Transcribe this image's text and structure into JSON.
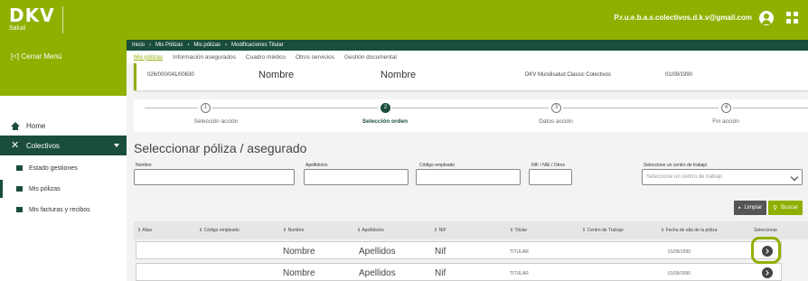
{
  "header": {
    "logo_text": "DKV",
    "logo_sub": "Salud",
    "user_email": "P.r.u.e.b.a.s.colectivos.d.k.v@gmail.com",
    "icons": [
      "user-icon",
      "apps-grid-icon"
    ]
  },
  "sidebar": {
    "close_menu": "[<] Cerrar Menú",
    "items": [
      {
        "label": "Home",
        "icon": "home-icon"
      },
      {
        "label": "Colectivos",
        "icon": "colectivos-icon"
      }
    ],
    "subitems": [
      {
        "label": "Estado gestiones",
        "icon": "document-icon"
      },
      {
        "label": "Mis pólizas",
        "icon": "policy-icon"
      },
      {
        "label": "Mis facturas y recibos",
        "icon": "invoice-icon"
      }
    ]
  },
  "breadcrumb": [
    "Inicio",
    "Mis Pólizas",
    "Mis pólizas",
    "Modificaciones Titular"
  ],
  "tabs": [
    "Mis pólizas",
    "Información asegurados",
    "Cuadro médico",
    "Otros servicios",
    "Gestión documental"
  ],
  "policy": {
    "number": "026/000/041/00630",
    "name1": "Nombre",
    "name2": "Nombre",
    "product": "DKV Mundisalud Classic Colectivos",
    "date": "01/09/1990"
  },
  "steps": [
    {
      "num": "1",
      "label": "Selección acción"
    },
    {
      "num": "2",
      "label": "Selección orden"
    },
    {
      "num": "3",
      "label": "Datos acción"
    },
    {
      "num": "4",
      "label": "Fin acción"
    }
  ],
  "form": {
    "title": "Seleccionar póliza / asegurado",
    "labels": {
      "nombre": "Nombre",
      "apellidos": "Apellido/os",
      "codigo": "Código empleado",
      "nif": "NIF / NIE / Otros",
      "centro": "Seleccione un centro de trabajo"
    },
    "centro_placeholder": "Seleccione un centro de trabajo",
    "clear_label": "Limpiar",
    "search_label": "Buscar"
  },
  "table": {
    "headers": [
      "Alias",
      "Código empleado",
      "Nombre",
      "Apellido/os",
      "NIF",
      "Titular",
      "Centro de Trabajo",
      "Fecha de alta de la póliza",
      "Seleccionar"
    ],
    "rows": [
      {
        "nombre": "Nombre",
        "apellidos": "Apellidos",
        "nif": "Nif",
        "titular": "TITULAR",
        "fecha": "01/09/1990"
      },
      {
        "nombre": "Nombre",
        "apellidos": "Apellidos",
        "nif": "Nif",
        "titular": "TITULAR",
        "fecha": "01/09/1990"
      }
    ]
  },
  "colors": {
    "brand_green": "#8fb000",
    "dark_green": "#1a4d3a"
  }
}
